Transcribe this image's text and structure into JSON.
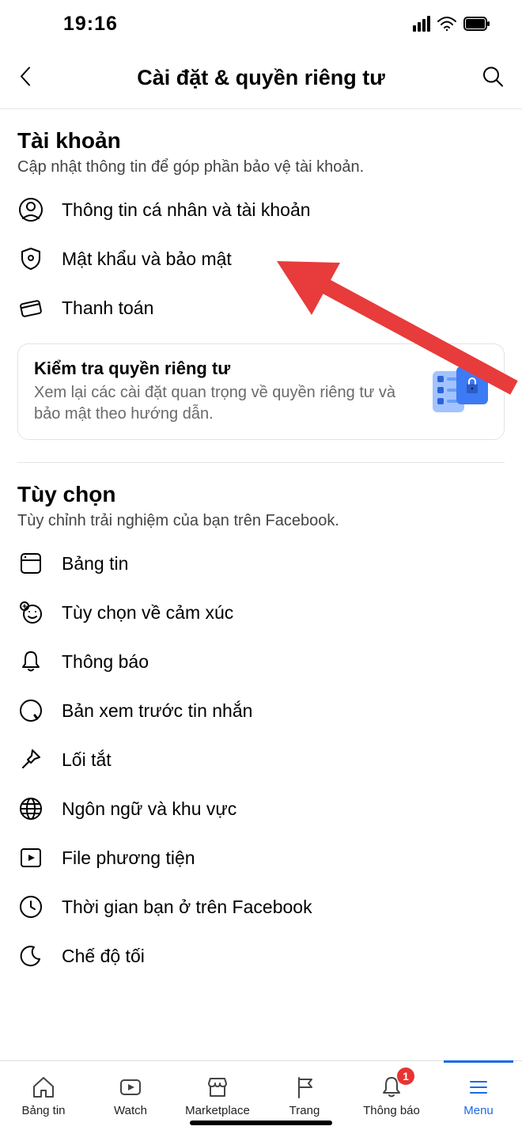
{
  "status": {
    "time": "19:16"
  },
  "nav": {
    "title": "Cài đặt & quyền riêng tư"
  },
  "account": {
    "title": "Tài khoản",
    "subtitle": "Cập nhật thông tin để góp phần bảo vệ tài khoản.",
    "items": [
      {
        "label": "Thông tin cá nhân và tài khoản"
      },
      {
        "label": "Mật khẩu và bảo mật"
      },
      {
        "label": "Thanh toán"
      }
    ]
  },
  "privacy_card": {
    "title": "Kiểm tra quyền riêng tư",
    "subtitle": "Xem lại các cài đặt quan trọng về quyền riêng tư và bảo mật theo hướng dẫn."
  },
  "prefs": {
    "title": "Tùy chọn",
    "subtitle": "Tùy chỉnh trải nghiệm của bạn trên Facebook.",
    "items": [
      {
        "label": "Bảng tin"
      },
      {
        "label": "Tùy chọn về cảm xúc"
      },
      {
        "label": "Thông báo"
      },
      {
        "label": "Bản xem trước tin nhắn"
      },
      {
        "label": "Lối tắt"
      },
      {
        "label": "Ngôn ngữ và khu vực"
      },
      {
        "label": "File phương tiện"
      },
      {
        "label": "Thời gian bạn ở trên Facebook"
      },
      {
        "label": "Chế độ tối"
      }
    ]
  },
  "tabs": {
    "items": [
      {
        "label": "Bảng tin"
      },
      {
        "label": "Watch"
      },
      {
        "label": "Marketplace"
      },
      {
        "label": "Trang"
      },
      {
        "label": "Thông báo"
      },
      {
        "label": "Menu"
      }
    ],
    "notif_badge": "1"
  }
}
